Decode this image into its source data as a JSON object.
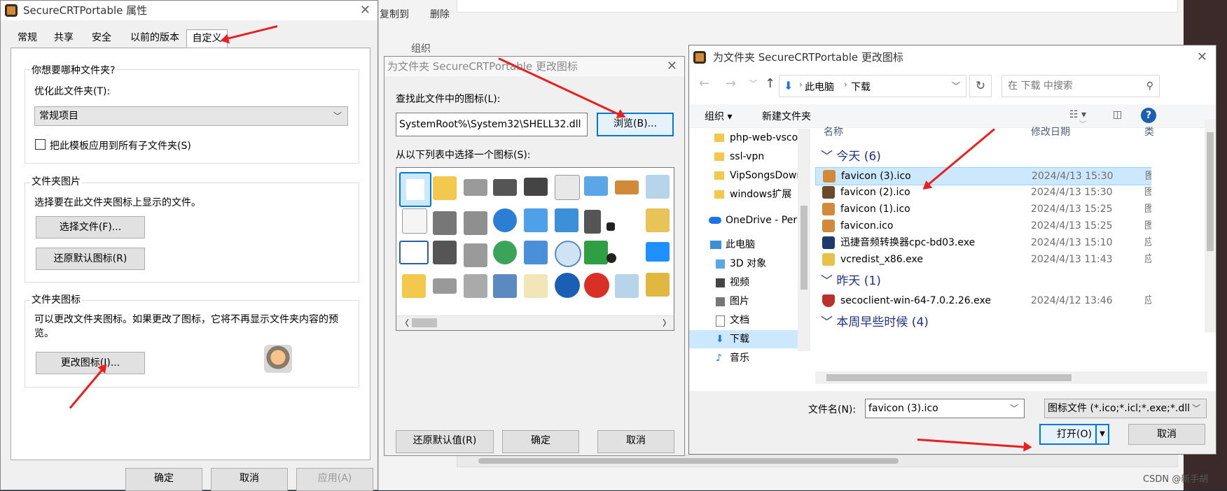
{
  "background": {
    "explorer_buttons": [
      "复制到",
      "删除"
    ],
    "explorer_group": "组织"
  },
  "props_window": {
    "title": "SecureCRTPortable 属性",
    "tabs": [
      "常规",
      "共享",
      "安全",
      "以前的版本",
      "自定义"
    ],
    "q_label": "你想要哪种文件夹?",
    "optimize_label": "优化此文件夹(T):",
    "optimize_value": "常规项目",
    "apply_checkbox": "把此模板应用到所有子文件夹(S)",
    "folder_pic_group": "文件夹图片",
    "folder_pic_desc": "选择要在此文件夹图标上显示的文件。",
    "choose_file_btn": "选择文件(F)...",
    "restore_default_icon_btn": "还原默认图标(R)",
    "folder_icon_group": "文件夹图标",
    "folder_icon_desc": "可以更改文件夹图标。如果更改了图标，它将不再显示文件夹内容的预览。",
    "change_icon_btn": "更改图标(I)...",
    "ok_btn": "确定",
    "cancel_btn": "取消",
    "apply_btn": "应用(A)"
  },
  "change_icon_dialog": {
    "title": "为文件夹 SecureCRTPortable 更改图标",
    "find_label": "查找此文件中的图标(L):",
    "path_value": "SystemRoot%\\System32\\SHELL32.dll",
    "browse_btn": "浏览(B)...",
    "choose_label": "从以下列表中选择一个图标(S):",
    "restore_btn": "还原默认值(R)",
    "ok_btn": "确定",
    "cancel_btn": "取消"
  },
  "file_dialog": {
    "title": "为文件夹 SecureCRTPortable 更改图标",
    "breadcrumb": [
      "此电脑",
      "下载"
    ],
    "search_placeholder": "在 下载 中搜索",
    "organize": "组织 ▾",
    "new_folder": "新建文件夹",
    "tree": [
      {
        "name": "php-web-vscode",
        "icon": "folder-icon"
      },
      {
        "name": "ssl-vpn",
        "icon": "folder-icon"
      },
      {
        "name": "VipSongsDown",
        "icon": "folder-icon"
      },
      {
        "name": "windows扩展",
        "icon": "folder-icon"
      },
      {
        "name": "OneDrive - Perso",
        "icon": "cloud-icon"
      },
      {
        "name": "此电脑",
        "icon": "pc-icon"
      },
      {
        "name": "3D 对象",
        "icon": "cube-icon"
      },
      {
        "name": "视频",
        "icon": "video-icon"
      },
      {
        "name": "图片",
        "icon": "image-icon"
      },
      {
        "name": "文档",
        "icon": "document-icon"
      },
      {
        "name": "下载",
        "icon": "download-icon"
      },
      {
        "name": "音乐",
        "icon": "music-icon"
      }
    ],
    "columns": {
      "name": "名称",
      "date": "修改日期",
      "type": "类"
    },
    "groups": [
      {
        "label": "今天 (6)",
        "files": [
          {
            "name": "favicon (3).ico",
            "date": "2024/4/13 15:30",
            "type": "图"
          },
          {
            "name": "favicon (2).ico",
            "date": "2024/4/13 15:30",
            "type": "图"
          },
          {
            "name": "favicon (1).ico",
            "date": "2024/4/13 15:25",
            "type": "图"
          },
          {
            "name": "favicon.ico",
            "date": "2024/4/13 15:25",
            "type": "图"
          },
          {
            "name": "迅捷音频转换器cpc-bd03.exe",
            "date": "2024/4/13 15:10",
            "type": "应"
          },
          {
            "name": "vcredist_x86.exe",
            "date": "2024/4/13 11:43",
            "type": "应"
          }
        ]
      },
      {
        "label": "昨天 (1)",
        "files": [
          {
            "name": "secoclient-win-64-7.0.2.26.exe",
            "date": "2024/4/12 13:46",
            "type": "应"
          }
        ]
      },
      {
        "label": "本周早些时候 (4)",
        "files": []
      }
    ],
    "filename_label": "文件名(N):",
    "filename_value": "favicon (3).ico",
    "filetype_value": "图标文件 (*.ico;*.icl;*.exe;*.dll",
    "open_btn": "打开(O)",
    "cancel_btn": "取消"
  },
  "watermark": "CSDN @新手胡",
  "colors": {
    "accent": "#0078d7",
    "arrow": "#e8201e",
    "selected_row": "#cce8ff"
  }
}
